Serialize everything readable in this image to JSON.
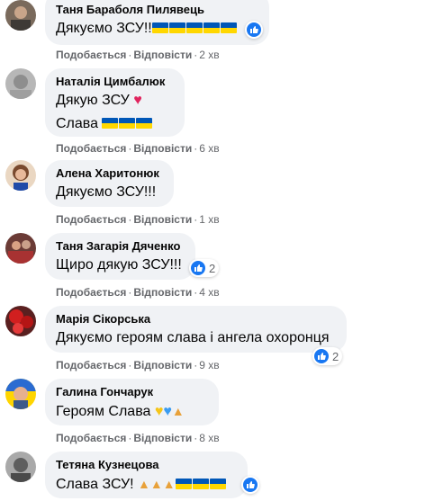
{
  "actions": {
    "like": "Подобається",
    "reply": "Відповісти"
  },
  "comments": [
    {
      "author": "Таня Бараболя Пилявець",
      "text": "Дякуємо ЗСУ!!",
      "emoji_after": "ukraine-flag x5",
      "time": "2 хв",
      "reactions": ""
    },
    {
      "author": "Наталія Цимбалюк",
      "text": "Дякую ЗСУ",
      "emoji_after": "red-heart",
      "text2": "Слава",
      "emoji_after2": "ukraine-flag x3",
      "time": "6 хв"
    },
    {
      "author": "Алена Харитонюк",
      "text": "Дякуємо ЗСУ!!!",
      "time": "1 хв"
    },
    {
      "author": "Таня Загарія Дяченко",
      "text": "Щиро дякую ЗСУ!!!",
      "time": "4 хв",
      "reactions": "2"
    },
    {
      "author": "Марія Сікорська",
      "text": "Дякуємо героям слава і ангела охоронця",
      "time": "9 хв",
      "reactions": "2"
    },
    {
      "author": "Галина Гончарук",
      "text": "Героям Слава",
      "emoji_after": "yellow-heart blue-heart folded-hands",
      "time": "8 хв"
    },
    {
      "author": "Тетяна Кузнецова",
      "text": "Слава ЗСУ!",
      "emoji_after": "folded-hands x3 ukraine-flag x3"
    }
  ],
  "colors": {
    "bubble": "#f0f2f5",
    "meta": "#65676b",
    "like": "#1877f2"
  }
}
